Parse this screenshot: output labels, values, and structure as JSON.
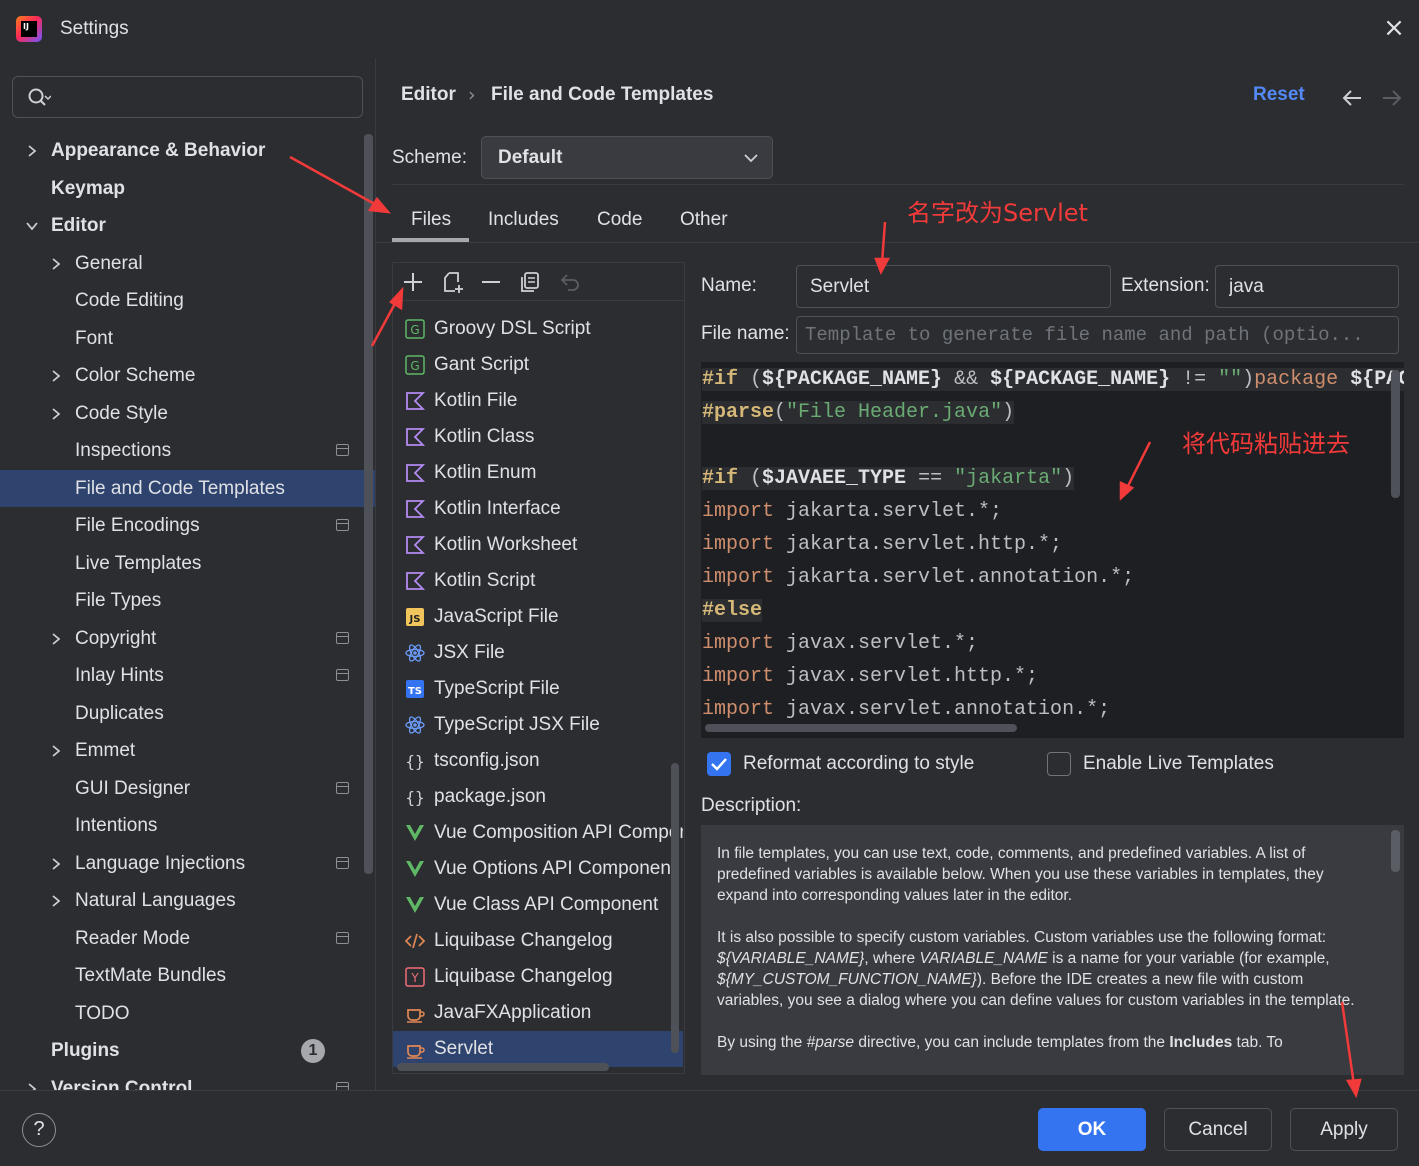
{
  "window": {
    "title": "Settings",
    "app_icon": "intellij-idea-icon",
    "close_icon": "close-icon"
  },
  "search": {
    "placeholder": "",
    "icon": "search-icon"
  },
  "sidebar": {
    "items": [
      {
        "label": "Appearance & Behavior",
        "level": 0,
        "expandable": true,
        "expanded": false,
        "bold": true
      },
      {
        "label": "Keymap",
        "level": 0,
        "expandable": false,
        "bold": true
      },
      {
        "label": "Editor",
        "level": 0,
        "expandable": true,
        "expanded": true,
        "bold": true
      },
      {
        "label": "General",
        "level": 1,
        "expandable": true
      },
      {
        "label": "Code Editing",
        "level": 1
      },
      {
        "label": "Font",
        "level": 1
      },
      {
        "label": "Color Scheme",
        "level": 1,
        "expandable": true
      },
      {
        "label": "Code Style",
        "level": 1,
        "expandable": true
      },
      {
        "label": "Inspections",
        "level": 1,
        "project_icon": true
      },
      {
        "label": "File and Code Templates",
        "level": 1,
        "selected": true
      },
      {
        "label": "File Encodings",
        "level": 1,
        "project_icon": true
      },
      {
        "label": "Live Templates",
        "level": 1
      },
      {
        "label": "File Types",
        "level": 1
      },
      {
        "label": "Copyright",
        "level": 1,
        "expandable": true,
        "project_icon": true
      },
      {
        "label": "Inlay Hints",
        "level": 1,
        "project_icon": true
      },
      {
        "label": "Duplicates",
        "level": 1
      },
      {
        "label": "Emmet",
        "level": 1,
        "expandable": true
      },
      {
        "label": "GUI Designer",
        "level": 1,
        "project_icon": true
      },
      {
        "label": "Intentions",
        "level": 1
      },
      {
        "label": "Language Injections",
        "level": 1,
        "expandable": true,
        "project_icon": true
      },
      {
        "label": "Natural Languages",
        "level": 1,
        "expandable": true
      },
      {
        "label": "Reader Mode",
        "level": 1,
        "project_icon": true
      },
      {
        "label": "TextMate Bundles",
        "level": 1
      },
      {
        "label": "TODO",
        "level": 1
      },
      {
        "label": "Plugins",
        "level": 0,
        "bold": true,
        "badge": "1"
      },
      {
        "label": "Version Control",
        "level": 0,
        "expandable": true,
        "bold": true,
        "project_icon": true
      }
    ]
  },
  "header": {
    "breadcrumb_parent": "Editor",
    "breadcrumb_sep": "›",
    "breadcrumb_current": "File and Code Templates",
    "reset_label": "Reset"
  },
  "scheme": {
    "label": "Scheme:",
    "value": "Default"
  },
  "tabs": [
    {
      "label": "Files",
      "active": true
    },
    {
      "label": "Includes"
    },
    {
      "label": "Code"
    },
    {
      "label": "Other"
    }
  ],
  "toolbar_icons": [
    "add-icon",
    "copy-template-icon",
    "remove-icon",
    "duplicate-icon",
    "revert-icon"
  ],
  "templates": [
    {
      "label": "Groovy DSL Script",
      "icon": "groovy-icon"
    },
    {
      "label": "Gant Script",
      "icon": "groovy-icon"
    },
    {
      "label": "Kotlin File",
      "icon": "kotlin-icon"
    },
    {
      "label": "Kotlin Class",
      "icon": "kotlin-icon"
    },
    {
      "label": "Kotlin Enum",
      "icon": "kotlin-icon"
    },
    {
      "label": "Kotlin Interface",
      "icon": "kotlin-icon"
    },
    {
      "label": "Kotlin Worksheet",
      "icon": "kotlin-icon"
    },
    {
      "label": "Kotlin Script",
      "icon": "kotlin-icon"
    },
    {
      "label": "JavaScript File",
      "icon": "javascript-icon"
    },
    {
      "label": "JSX File",
      "icon": "react-icon"
    },
    {
      "label": "TypeScript File",
      "icon": "typescript-icon"
    },
    {
      "label": "TypeScript JSX File",
      "icon": "react-icon"
    },
    {
      "label": "tsconfig.json",
      "icon": "json-icon"
    },
    {
      "label": "package.json",
      "icon": "json-icon"
    },
    {
      "label": "Vue Composition API Component",
      "icon": "vue-icon"
    },
    {
      "label": "Vue Options API Component",
      "icon": "vue-icon"
    },
    {
      "label": "Vue Class API Component",
      "icon": "vue-icon"
    },
    {
      "label": "Liquibase Changelog",
      "icon": "xml-icon"
    },
    {
      "label": "Liquibase Changelog",
      "icon": "yaml-icon"
    },
    {
      "label": "JavaFXApplication",
      "icon": "java-cup-icon"
    },
    {
      "label": "Servlet",
      "icon": "java-cup-icon",
      "selected": true
    }
  ],
  "fields": {
    "name_label": "Name:",
    "name_value": "Servlet",
    "extension_label": "Extension:",
    "extension_value": "java",
    "filename_label": "File name:",
    "filename_placeholder": "Template to generate file name and path (optio..."
  },
  "code": {
    "lines": [
      {
        "hl": true,
        "tokens": [
          [
            "dir",
            "#if"
          ],
          [
            "pl",
            " ("
          ],
          [
            "var",
            "${PACKAGE_NAME}"
          ],
          [
            "pl",
            " && "
          ],
          [
            "var",
            "${PACKAGE_NAME}"
          ],
          [
            "pl",
            " != "
          ],
          [
            "str",
            "\"\""
          ],
          [
            "pl",
            ")"
          ],
          [
            "kw",
            "package"
          ],
          [
            "pl",
            " "
          ],
          [
            "var",
            "${PACKAGE_NAME};"
          ]
        ]
      },
      {
        "hl": true,
        "tokens": [
          [
            "dir",
            "#parse"
          ],
          [
            "pl",
            "("
          ],
          [
            "str",
            "\"File Header.java\""
          ],
          [
            "pl",
            ")"
          ]
        ]
      },
      {
        "hl": false,
        "tokens": []
      },
      {
        "hl": true,
        "tokens": [
          [
            "dir",
            "#if"
          ],
          [
            "pl",
            " ("
          ],
          [
            "var",
            "$JAVAEE_TYPE"
          ],
          [
            "pl",
            " == "
          ],
          [
            "str",
            "\"jakarta\""
          ],
          [
            "pl",
            ")"
          ]
        ]
      },
      {
        "hl": false,
        "tokens": [
          [
            "kw",
            "import"
          ],
          [
            "pl",
            " jakarta.servlet.*;"
          ]
        ]
      },
      {
        "hl": false,
        "tokens": [
          [
            "kw",
            "import"
          ],
          [
            "pl",
            " jakarta.servlet.http.*;"
          ]
        ]
      },
      {
        "hl": false,
        "tokens": [
          [
            "kw",
            "import"
          ],
          [
            "pl",
            " jakarta.servlet.annotation.*;"
          ]
        ]
      },
      {
        "hl": true,
        "tokens": [
          [
            "dir",
            "#else"
          ]
        ]
      },
      {
        "hl": false,
        "tokens": [
          [
            "kw",
            "import"
          ],
          [
            "pl",
            " javax.servlet.*;"
          ]
        ]
      },
      {
        "hl": false,
        "tokens": [
          [
            "kw",
            "import"
          ],
          [
            "pl",
            " javax.servlet.http.*;"
          ]
        ]
      },
      {
        "hl": false,
        "tokens": [
          [
            "kw",
            "import"
          ],
          [
            "pl",
            " javax.servlet.annotation.*;"
          ]
        ]
      }
    ]
  },
  "options": {
    "reformat_label": "Reformat according to style",
    "reformat_checked": true,
    "live_templates_label": "Enable Live Templates",
    "live_templates_checked": false
  },
  "description": {
    "label": "Description:",
    "p1": "In file templates, you can use text, code, comments, and predefined variables. A list of predefined variables is available below. When you use these variables in templates, they expand into corresponding values later in the editor.",
    "p2a": "It is also possible to specify custom variables. Custom variables use the following format: ",
    "p2b": "${VARIABLE_NAME}",
    "p2c": ", where ",
    "p2d": "VARIABLE_NAME",
    "p2e": " is a name for your variable (for example, ",
    "p2f": "${MY_CUSTOM_FUNCTION_NAME}",
    "p2g": "). Before the IDE creates a new file with custom variables, you see a dialog where you can define values for custom variables in the template.",
    "p3a": "By using the ",
    "p3b": "#parse",
    "p3c": " directive, you can include templates from the ",
    "p3d": "Includes",
    "p3e": " tab. To"
  },
  "buttons": {
    "help": "?",
    "ok": "OK",
    "cancel": "Cancel",
    "apply": "Apply"
  },
  "annotations": {
    "rename_note": "名字改为Servlet",
    "paste_note": "将代码粘贴进去",
    "color": "#f23a3a"
  },
  "colors": {
    "background": "#2b2d30",
    "selection": "#2e436e",
    "accent": "#3574f0",
    "link": "#548af7",
    "editor_bg": "#1e1f22"
  }
}
